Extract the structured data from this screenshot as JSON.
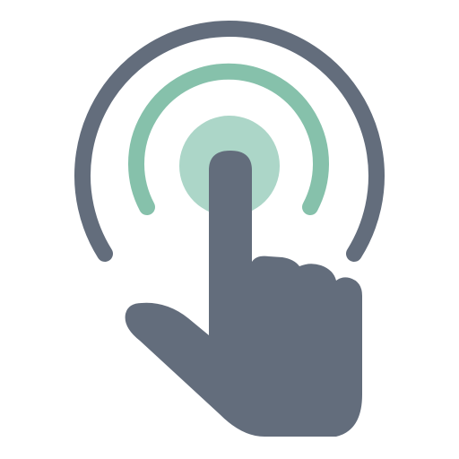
{
  "icon": {
    "name": "tap-gesture-icon",
    "colors": {
      "hand": "#636d7c",
      "outer_ring": "#636d7c",
      "middle_ring": "#86c1ab",
      "touch_point": "#acd6c8",
      "background": "#ffffff"
    }
  }
}
